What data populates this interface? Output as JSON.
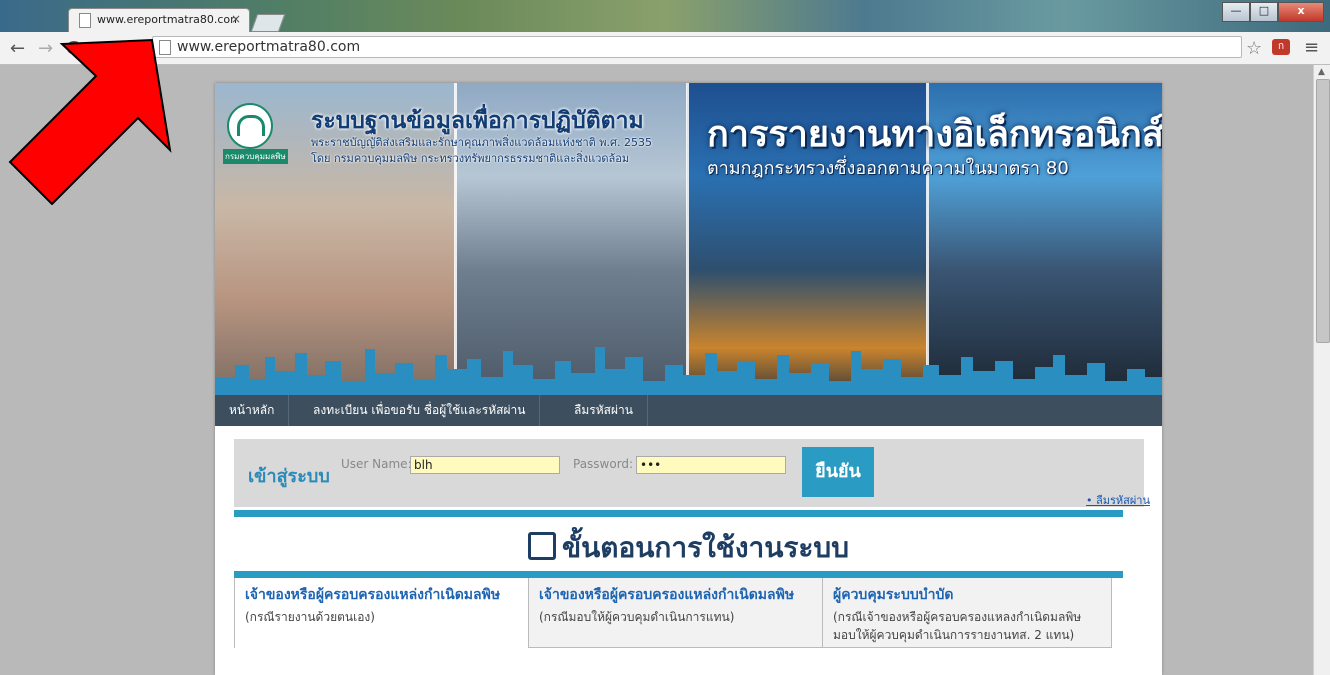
{
  "browser": {
    "tab_title": "www.ereportmatra80.com",
    "tab_close": "×",
    "url": "www.ereportmatra80.com",
    "buttons": {
      "back": "←",
      "forward": "→",
      "reload": "C",
      "bookmark": "☆",
      "menu": "≡",
      "minimize": "—",
      "maximize": "□",
      "close": "x"
    }
  },
  "banner": {
    "system_title": "ระบบฐานข้อมูลเพื่อการปฏิบัติตาม",
    "system_sub1": "พระราชบัญญัติส่งเสริมและรักษาคุณภาพสิ่งแวดล้อมแห่งชาติ พ.ศ. 2535",
    "system_sub2": "โดย กรมควบคุมมลพิษ กระทรวงทรัพยากรธรรมชาติและสิ่งแวดล้อม",
    "logo_caption": "กรมควบคุมมลพิษ",
    "main_title": "การรายงานทางอิเล็กทรอนิกส์",
    "main_sub": "ตามกฎกระทรวงซึ่งออกตามความในมาตรา 80"
  },
  "nav": {
    "items": [
      {
        "label": "หน้าหลัก"
      },
      {
        "label": "ลงทะเบียน เพื่อขอรับ ชื่อผู้ใช้และรหัสผ่าน"
      },
      {
        "label": "ลืมรหัสผ่าน"
      }
    ]
  },
  "login": {
    "title": "เข้าสู่ระบบ",
    "username_label": "User Name:",
    "username_value": "blh",
    "password_label": "Password:",
    "password_value": "•••",
    "submit": "ยืนยัน",
    "forgot": "• ลืมรหัสผ่าน"
  },
  "steps": {
    "title": "ขั้นตอนการใช้งานระบบ",
    "columns": [
      {
        "heading": "เจ้าของหรือผู้ครอบครองแหล่งกำเนิดมลพิษ",
        "sub": "(กรณีรายงานด้วยตนเอง)"
      },
      {
        "heading": "เจ้าของหรือผู้ครอบครองแหล่งกำเนิดมลพิษ",
        "sub": "(กรณีมอบให้ผู้ควบคุมดำเนินการแทน)"
      },
      {
        "heading": "ผู้ควบคุมระบบบำบัด",
        "sub": "(กรณีเจ้าของหรือผู้ครอบครองแหลงกำเนิดมลพิษ มอบให้ผู้ควบคุมดำเนินการรายงานทส. 2 แทน)"
      }
    ]
  },
  "colors": {
    "accent": "#2a9bc2",
    "nav_bg": "#3d4f5e",
    "heading_blue": "#1d64b3",
    "arrow_red": "#ff0000"
  }
}
